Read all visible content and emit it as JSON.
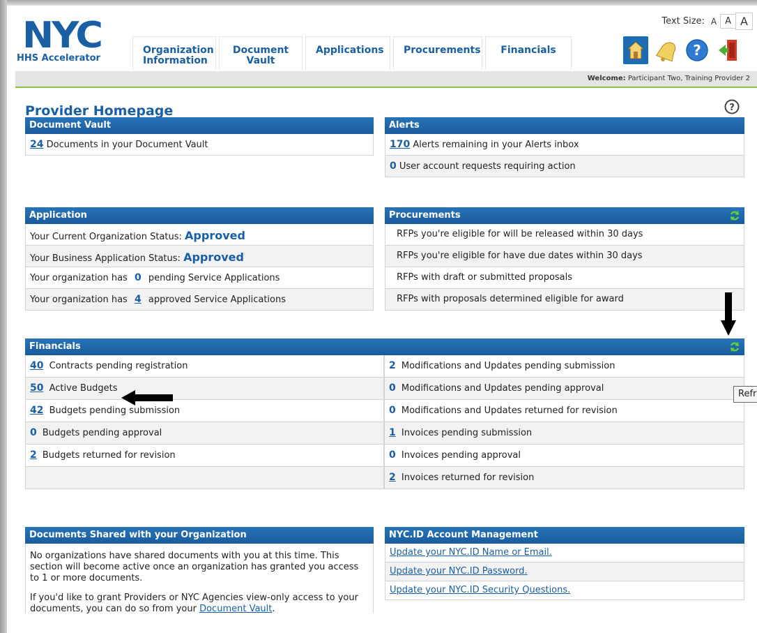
{
  "header": {
    "logo_text": "NYC",
    "logo_subtitle": "HHS Accelerator",
    "nav": [
      {
        "line1": "Organization",
        "line2": "Information"
      },
      {
        "line1": "Document",
        "line2": "Vault"
      },
      {
        "line1": "Applications",
        "line2": ""
      },
      {
        "line1": "Procurements",
        "line2": ""
      },
      {
        "line1": "Financials",
        "line2": ""
      }
    ],
    "text_size_label": "Text Size:",
    "text_size_options": [
      "A",
      "A",
      "A"
    ],
    "welcome_label": "Welcome:",
    "welcome_user": "Participant Two, Training Provider 2"
  },
  "page_title": "Provider Homepage",
  "document_vault": {
    "title": "Document Vault",
    "count": "24",
    "text": "Documents in your Document Vault"
  },
  "alerts": {
    "title": "Alerts",
    "rows": [
      {
        "count": "170",
        "text": "Alerts remaining in your Alerts inbox"
      },
      {
        "count": "0",
        "text": "User account requests requiring action"
      }
    ]
  },
  "application": {
    "title": "Application",
    "org_status_label": "Your Current Organization Status:",
    "org_status_value": "Approved",
    "biz_status_label": "Your Business Application Status:",
    "biz_status_value": "Approved",
    "pending_prefix": "Your organization has",
    "pending_count": "0",
    "pending_suffix": "pending Service Applications",
    "approved_prefix": "Your organization has",
    "approved_count": "4",
    "approved_suffix": "approved Service Applications"
  },
  "procurements": {
    "title": "Procurements",
    "rows": [
      "RFPs you're eligible for will be released within 30 days",
      "RFPs you're eligible for have due dates within 30 days",
      "RFPs with draft or submitted proposals",
      "RFPs with proposals determined eligible for award"
    ]
  },
  "financials": {
    "title": "Financials",
    "left": [
      {
        "count": "40",
        "text": "Contracts pending registration",
        "link": true
      },
      {
        "count": "50",
        "text": "Active Budgets",
        "link": true
      },
      {
        "count": "42",
        "text": "Budgets pending submission",
        "link": true
      },
      {
        "count": "0",
        "text": "Budgets pending approval",
        "link": false
      },
      {
        "count": "2",
        "text": "Budgets returned for revision",
        "link": true
      },
      {
        "count": "",
        "text": "",
        "link": false
      }
    ],
    "right": [
      {
        "count": "2",
        "text": "Modifications and Updates pending submission",
        "link": false
      },
      {
        "count": "0",
        "text": "Modifications and Updates pending approval",
        "link": false
      },
      {
        "count": "0",
        "text": "Modifications and Updates returned for revision",
        "link": false
      },
      {
        "count": "1",
        "text": "Invoices pending submission",
        "link": true
      },
      {
        "count": "0",
        "text": "Invoices pending approval",
        "link": false
      },
      {
        "count": "2",
        "text": "Invoices returned for revision",
        "link": true
      }
    ],
    "tooltip": "Refresh"
  },
  "documents_shared": {
    "title": "Documents Shared with your Organization",
    "para1": "No organizations have shared documents with you at this time. This section will become active once an organization has granted you access to 1 or more documents.",
    "para2_prefix": "If you'd like to grant Providers or NYC Agencies view-only access to your documents, you can do so from your",
    "para2_link": "Document Vault",
    "para2_suffix": "."
  },
  "nycid": {
    "title": "NYC.ID Account Management",
    "links": [
      "Update your NYC.ID Name or Email.",
      "Update your NYC.ID Password.",
      "Update your NYC.ID Security Questions."
    ]
  },
  "colors": {
    "brand_blue": "#1a5fa3",
    "panel_header": "#1a5c9c",
    "accent_green": "#8cc43b"
  }
}
